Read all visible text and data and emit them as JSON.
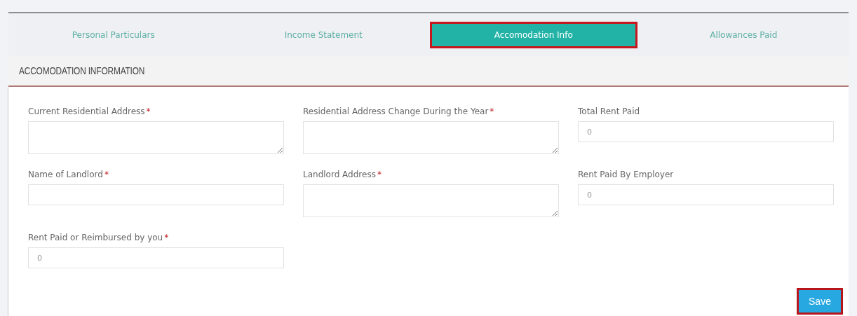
{
  "tabs": [
    {
      "label": "Personal Particulars",
      "selected": false,
      "highlighted": false
    },
    {
      "label": "Income Statement",
      "selected": false,
      "highlighted": false
    },
    {
      "label": "Accomodation Info",
      "selected": true,
      "highlighted": true
    },
    {
      "label": "Allowances Paid",
      "selected": false,
      "highlighted": false
    }
  ],
  "section": {
    "title": "ACCOMODATION INFORMATION"
  },
  "fields": [
    {
      "label": "Current Residential Address",
      "required_mark": "*",
      "kind": "textarea"
    },
    {
      "label": "Residential Address Change During the Year",
      "required_mark": "*",
      "kind": "textarea"
    },
    {
      "label": "Total Rent Paid",
      "kind": "input",
      "placeholder": "0"
    },
    {
      "label": "Name of Landlord",
      "required_mark": "*",
      "kind": "input"
    },
    {
      "label": "Landlord Address",
      "required_mark": "*",
      "kind": "textarea"
    },
    {
      "label": "Rent Paid By Employer",
      "kind": "input",
      "placeholder": "0"
    },
    {
      "label": "Rent Paid or Reimbursed by you",
      "required_mark": "*",
      "kind": "input",
      "placeholder": "0"
    }
  ],
  "save_button": {
    "label": "Save",
    "highlighted": true
  }
}
